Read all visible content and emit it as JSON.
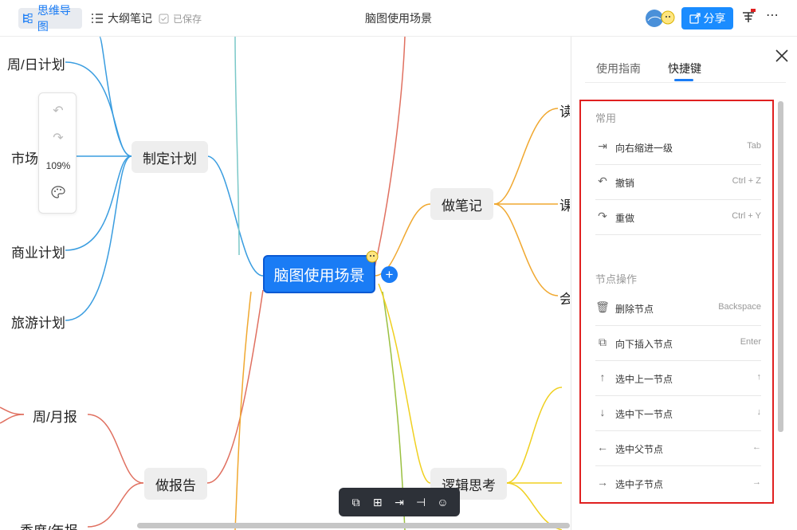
{
  "topbar": {
    "mindmap_label": "思维导图",
    "outline_label": "大纲笔记",
    "saved_label": "已保存",
    "doc_title": "脑图使用场景",
    "share_label": "分享"
  },
  "zoom": {
    "level": "109%"
  },
  "mindmap": {
    "root": "脑图使用场景",
    "branches": [
      "制定计划",
      "做笔记",
      "做报告",
      "逻辑思考"
    ],
    "leaves_plan": [
      "周/日计划",
      "市场",
      "商业计划",
      "旅游计划"
    ],
    "leaves_notes": [
      "读",
      "课",
      "会"
    ],
    "leaves_report": [
      "周/月报",
      "季度/年报"
    ]
  },
  "panel": {
    "tabs": [
      "使用指南",
      "快捷键"
    ],
    "active_tab": "快捷键",
    "sections": [
      {
        "title": "常用",
        "items": [
          {
            "icon": "indent-right-icon",
            "label": "向右缩进一级",
            "key": "Tab"
          },
          {
            "icon": "undo-icon",
            "label": "撤销",
            "key": "Ctrl + Z"
          },
          {
            "icon": "redo-icon",
            "label": "重做",
            "key": "Ctrl + Y"
          }
        ]
      },
      {
        "title": "节点操作",
        "items": [
          {
            "icon": "trash-icon",
            "label": "删除节点",
            "key": "Backspace"
          },
          {
            "icon": "insert-below-icon",
            "label": "向下插入节点",
            "key": "Enter"
          },
          {
            "icon": "arrow-up-icon",
            "label": "选中上一节点",
            "key": "↑"
          },
          {
            "icon": "arrow-down-icon",
            "label": "选中下一节点",
            "key": "↓"
          },
          {
            "icon": "arrow-left-icon",
            "label": "选中父节点",
            "key": "←"
          },
          {
            "icon": "arrow-right-icon",
            "label": "选中子节点",
            "key": "→"
          }
        ]
      }
    ]
  },
  "colors": {
    "accent": "#1a7cf5",
    "highlight_box": "#e02020",
    "branch_blue": "#3a9de0",
    "branch_orange": "#f0a830",
    "branch_red": "#e07060",
    "branch_yellow": "#f0d020"
  }
}
